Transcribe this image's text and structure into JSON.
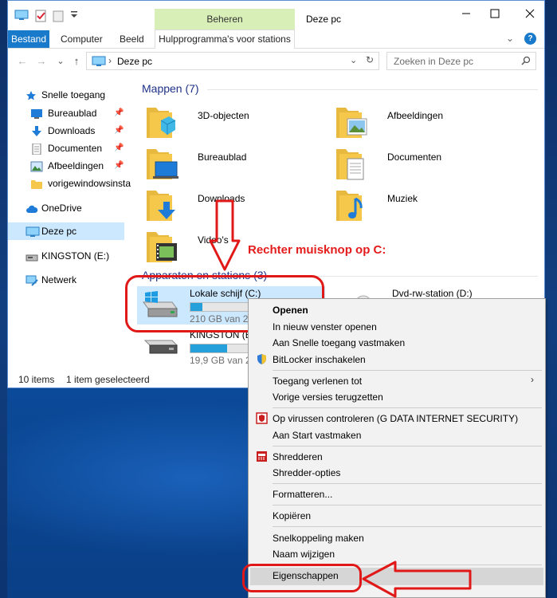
{
  "window": {
    "title": "Deze pc",
    "context_tab": "Beheren",
    "controls": {
      "minimize": "—",
      "maximize": "☐",
      "close": "✕"
    }
  },
  "ribbon": {
    "tabs": [
      "Bestand",
      "Computer",
      "Beeld",
      "Hulpprogramma's voor stations"
    ],
    "expand": "⌄",
    "help": "?"
  },
  "navigation": {
    "back": "←",
    "forward": "→",
    "recent": "⌄",
    "up": "↑",
    "address_sep": "›",
    "address": "Deze pc",
    "address_dropdown": "⌄",
    "refresh": "↻",
    "search_placeholder": "Zoeken in Deze pc"
  },
  "sidebar": {
    "quick_access": "Snelle toegang",
    "pinned": [
      {
        "label": "Bureaublad",
        "icon": "desktop-folder-icon",
        "pinned": true
      },
      {
        "label": "Downloads",
        "icon": "downloads-folder-icon",
        "pinned": true
      },
      {
        "label": "Documenten",
        "icon": "documents-folder-icon",
        "pinned": true
      },
      {
        "label": "Afbeeldingen",
        "icon": "pictures-folder-icon",
        "pinned": true
      },
      {
        "label": "vorigewindowsinsta",
        "icon": "folder-icon",
        "pinned": false
      }
    ],
    "onedrive": "OneDrive",
    "this_pc": "Deze pc",
    "usb": "KINGSTON (E:)",
    "network": "Netwerk",
    "pin_glyph": "📌"
  },
  "main": {
    "folders_header": "Mappen (7)",
    "folders": [
      {
        "label": "3D-objecten",
        "icon": "3d-objects-folder-icon"
      },
      {
        "label": "Afbeeldingen",
        "icon": "pictures-folder-icon"
      },
      {
        "label": "Bureaublad",
        "icon": "desktop-folder-icon"
      },
      {
        "label": "Documenten",
        "icon": "documents-folder-icon"
      },
      {
        "label": "Downloads",
        "icon": "downloads-folder-icon"
      },
      {
        "label": "Muziek",
        "icon": "music-folder-icon"
      },
      {
        "label": "Video's",
        "icon": "videos-folder-icon"
      }
    ],
    "devices_header": "Apparaten en stations (3)",
    "drives": [
      {
        "name": "Lokale schijf (C:)",
        "free": "210 GB van 232 GB",
        "used_fraction": 0.1,
        "selected": true
      },
      {
        "name": "KINGSTON (E:)",
        "free": "19,9 GB van 28,8 GB",
        "used_fraction": 0.31,
        "selected": false
      },
      {
        "name": "Dvd-rw-station (D:)",
        "free": "",
        "used_fraction": null,
        "selected": false
      }
    ]
  },
  "status": {
    "items": "10 items",
    "selected": "1 item geselecteerd"
  },
  "context_menu": {
    "items": [
      {
        "label": "Openen",
        "bold": true,
        "icon": ""
      },
      {
        "label": "In nieuw venster openen",
        "icon": ""
      },
      {
        "label": "Aan Snelle toegang vastmaken",
        "icon": ""
      },
      {
        "label": "BitLocker inschakelen",
        "icon": "shield-icon"
      },
      {
        "label": "Toegang verlenen tot",
        "icon": "",
        "submenu": true
      },
      {
        "label": "Vorige versies terugzetten",
        "icon": ""
      },
      {
        "label": "Op virussen controleren (G DATA INTERNET SECURITY)",
        "icon": "gdata-icon"
      },
      {
        "label": "Aan Start vastmaken",
        "icon": ""
      },
      {
        "label": "Shredderen",
        "icon": "shredder-icon"
      },
      {
        "label": "Shredder-opties",
        "icon": ""
      },
      {
        "label": "Formatteren...",
        "icon": ""
      },
      {
        "label": "Kopiëren",
        "icon": ""
      },
      {
        "label": "Snelkoppeling maken",
        "icon": ""
      },
      {
        "label": "Naam wijzigen",
        "icon": ""
      },
      {
        "label": "Eigenschappen",
        "icon": ""
      }
    ],
    "submenu_arrow": "›"
  },
  "annotation": {
    "text": "Rechter muisknop op  C:",
    "color": "#e41c1c"
  },
  "colors": {
    "accent": "#1979ca",
    "context_tab": "#d8efb8",
    "selection": "#cce8ff",
    "drive_bar": "#26a0da",
    "annotation_red": "#e01818"
  }
}
